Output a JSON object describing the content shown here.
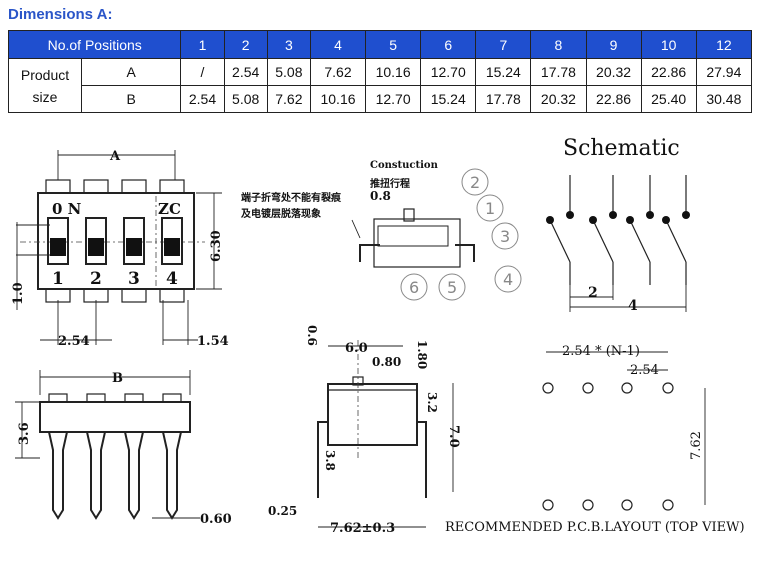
{
  "title": "Dimensions A:",
  "table": {
    "header_label": "No.of Positions",
    "positions": [
      "1",
      "2",
      "3",
      "4",
      "5",
      "6",
      "7",
      "8",
      "9",
      "10",
      "12"
    ],
    "row_group_label": [
      "Product",
      "size"
    ],
    "rows": [
      {
        "label": "A",
        "values": [
          "/",
          "2.54",
          "5.08",
          "7.62",
          "10.16",
          "12.70",
          "15.24",
          "17.78",
          "20.32",
          "22.86",
          "27.94"
        ]
      },
      {
        "label": "B",
        "values": [
          "2.54",
          "5.08",
          "7.62",
          "10.16",
          "12.70",
          "15.24",
          "17.78",
          "20.32",
          "22.86",
          "25.40",
          "30.48"
        ]
      }
    ],
    "header_color": "#1f4fcf"
  },
  "top_view": {
    "dim_a": "A",
    "on_label": "0 N",
    "logo": "ZC",
    "switch_numbers": [
      "1",
      "2",
      "3",
      "4"
    ],
    "dim_height": "6.30",
    "dim_stroke": "1.0",
    "dim_pitch": "2.54",
    "dim_pin": "1.54"
  },
  "construction": {
    "title": "Constuction",
    "travel_label": "推扭行程",
    "travel_value": "0.8",
    "note_line1": "端子折弯处不能有裂痕",
    "note_line2": "及电镀层脱落现象",
    "callouts": [
      "1",
      "2",
      "3",
      "4",
      "5",
      "6"
    ]
  },
  "schematic": {
    "title": "Schematic",
    "dim_2": "2",
    "dim_4": "4"
  },
  "side_view": {
    "dim_b": "B",
    "dim_height": "3.6",
    "dim_pin": "0.60"
  },
  "end_view": {
    "d_0_6": "0.6",
    "d_6_0": "6.0",
    "d_0_80": "0.80",
    "d_1_80": "1.80",
    "d_3_2": "3.2",
    "d_7_0": "7.0",
    "d_3_8": "3.8",
    "d_0_25": "0.25",
    "d_7_62": "7.62±0.3"
  },
  "pcb": {
    "dim_span": "2.54 * (N-1)",
    "dim_pitch": "2.54",
    "dim_row": "7.62",
    "caption": "RECOMMENDED P.C.B.LAYOUT (TOP VIEW)"
  }
}
